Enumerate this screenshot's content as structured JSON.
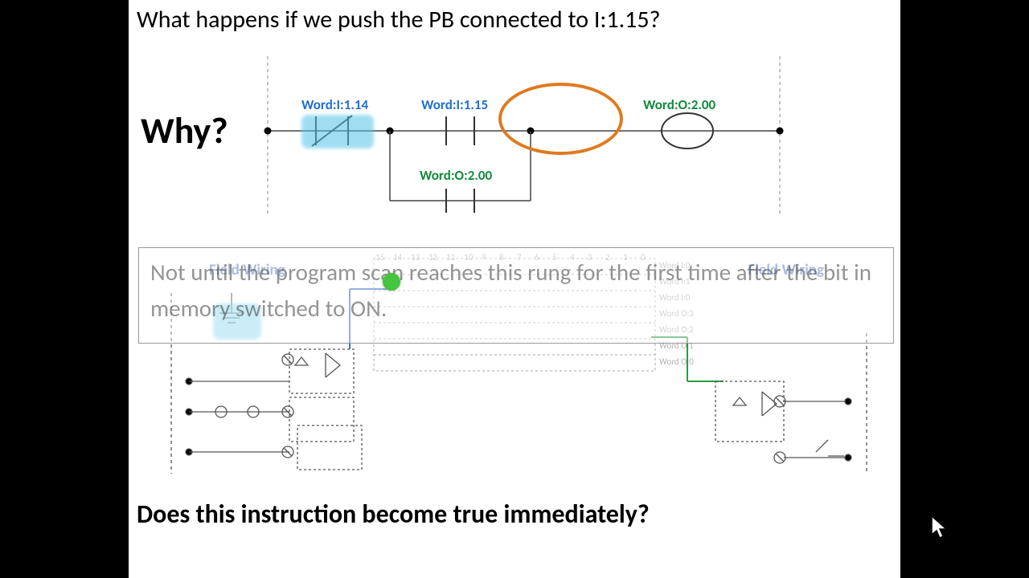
{
  "title": "What happens if we push the PB connected to I:1.15?",
  "why": "Why?",
  "bottom_question": "Does this instruction become true immediately?",
  "answer": "Not until the program scan reaches this rung for the first time after the bit in memory switched to ON.",
  "ladder": {
    "xic_nc_label": "Word:I:1.14",
    "xic_no_label": "Word:I:1.15",
    "branch_label": "Word:O:2.00",
    "coil_label": "Word:O:2.00"
  },
  "field_wiring_left": "Field Wiring",
  "field_wiring_right": "Field Wiring",
  "mem_bits": [
    "15",
    "14",
    "13",
    "12",
    "11",
    "10",
    "9",
    "8",
    "7",
    "6",
    "5",
    "4",
    "3",
    "2",
    "1",
    "0"
  ],
  "mem_words": [
    "Word I:0",
    "Word I:1",
    "Word I:0",
    "Word O:3",
    "Word O:2",
    "Word O:1",
    "Word O:0"
  ]
}
